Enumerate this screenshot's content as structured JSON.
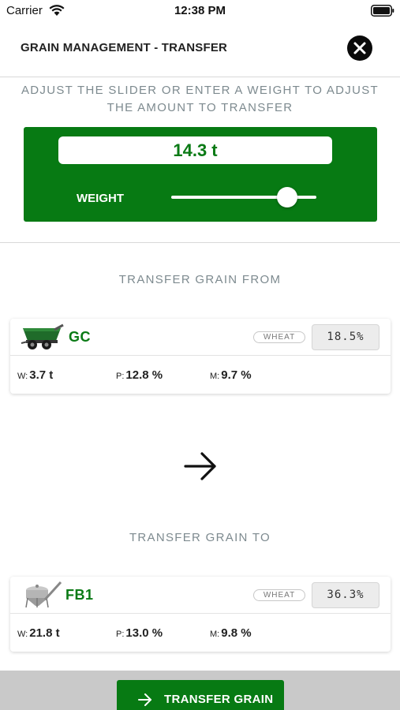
{
  "status_bar": {
    "carrier": "Carrier",
    "time": "12:38 PM",
    "icons": [
      "wifi-icon",
      "battery-icon"
    ]
  },
  "header": {
    "title": "GRAIN MANAGEMENT - TRANSFER",
    "close_icon": "close-icon"
  },
  "instruction": "ADJUST THE SLIDER OR ENTER A WEIGHT TO ADJUST THE AMOUNT TO TRANSFER",
  "weight": {
    "value": "14.3 t",
    "label": "WEIGHT",
    "slider_fraction": 0.8
  },
  "transfer_from": {
    "heading": "TRANSFER GRAIN FROM",
    "name": "GC",
    "icon": "grain-cart-icon",
    "crop": "WHEAT",
    "moisture_display": "18.5%",
    "w_label": "W:",
    "w_value": "3.7 t",
    "p_label": "P:",
    "p_value": "12.8 %",
    "m_label": "M:",
    "m_value": "9.7 %"
  },
  "direction_icon": "arrow-right-icon",
  "transfer_to": {
    "heading": "TRANSFER GRAIN TO",
    "name": "FB1",
    "icon": "field-bin-icon",
    "crop": "WHEAT",
    "moisture_display": "36.3%",
    "w_label": "W:",
    "w_value": "21.8 t",
    "p_label": "P:",
    "p_value": "13.0 %",
    "m_label": "M:",
    "m_value": "9.8 %"
  },
  "action": {
    "label": "TRANSFER GRAIN",
    "icon": "arrow-right-icon"
  },
  "colors": {
    "accent_green": "#077a13",
    "text_green": "#0a7a15",
    "muted_text": "#7d8a8f",
    "footer_gray": "#c9c9c9"
  }
}
